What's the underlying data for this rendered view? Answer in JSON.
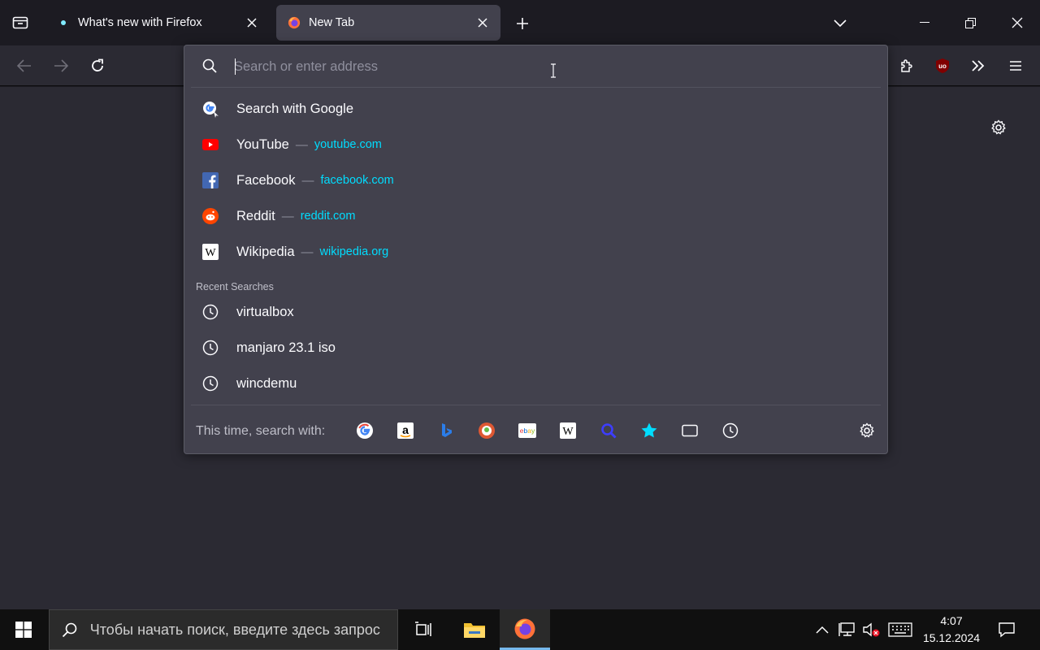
{
  "tabs": [
    {
      "title": "What's new with Firefox",
      "active": false
    },
    {
      "title": "New Tab",
      "active": true
    }
  ],
  "urlbar": {
    "placeholder": "Search or enter address"
  },
  "suggestions": {
    "search_with": "Search with Google",
    "sites": [
      {
        "name": "YouTube",
        "url": "youtube.com",
        "icon": "youtube-icon"
      },
      {
        "name": "Facebook",
        "url": "facebook.com",
        "icon": "facebook-icon"
      },
      {
        "name": "Reddit",
        "url": "reddit.com",
        "icon": "reddit-icon"
      },
      {
        "name": "Wikipedia",
        "url": "wikipedia.org",
        "icon": "wikipedia-icon"
      }
    ],
    "dash": "—",
    "recent_label": "Recent Searches",
    "recent": [
      "virtualbox",
      "manjaro 23.1 iso",
      "wincdemu"
    ]
  },
  "footer": {
    "label": "This time, search with:",
    "engines": [
      "google",
      "amazon",
      "bing",
      "duckduckgo",
      "ebay",
      "wikipedia",
      "search",
      "bookmarks",
      "tabs",
      "history"
    ]
  },
  "taskbar": {
    "search_placeholder": "Чтобы начать поиск, введите здесь запрос",
    "time": "4:07",
    "date": "15.12.2024"
  },
  "colors": {
    "accent_url": "#00ddff",
    "panel_bg": "#42414d",
    "toolbar_bg": "#2b2a33",
    "tabbar_bg": "#1c1b22"
  }
}
